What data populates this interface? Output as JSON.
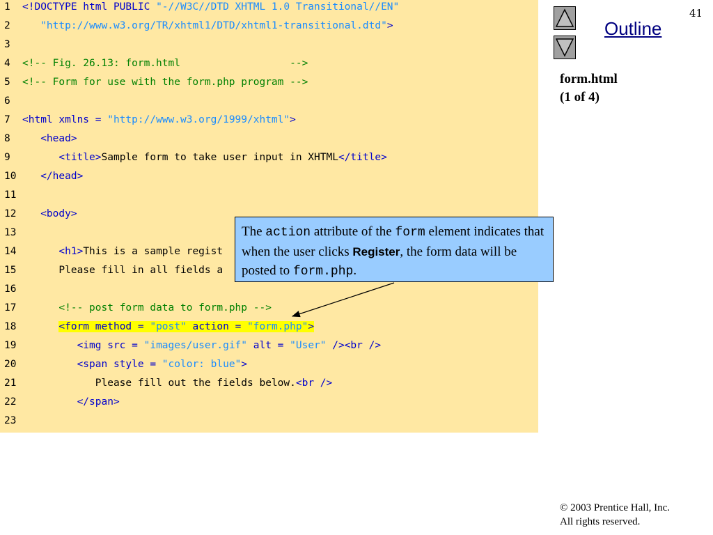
{
  "slide_number": "41",
  "outline_label": "Outline",
  "nav": {
    "up_icon": "triangle-up-icon",
    "down_icon": "triangle-down-icon"
  },
  "file": {
    "name": "form.html",
    "part": "(1 of 4)"
  },
  "code_lines": [
    {
      "num": "1",
      "indent": "",
      "tokens": [
        [
          "tag",
          "<!DOCTYPE html PUBLIC "
        ],
        [
          "str",
          "\"-//W3C//DTD XHTML 1.0 Transitional//EN\""
        ]
      ]
    },
    {
      "num": "2",
      "indent": "   ",
      "tokens": [
        [
          "str",
          "\"http://www.w3.org/TR/xhtml1/DTD/xhtml1-transitional.dtd\""
        ],
        [
          "tag",
          ">"
        ]
      ]
    },
    {
      "num": "3",
      "indent": "",
      "tokens": []
    },
    {
      "num": "4",
      "indent": "",
      "tokens": [
        [
          "cmt",
          "<!-- Fig. 26.13: form.html                  -->"
        ]
      ]
    },
    {
      "num": "5",
      "indent": "",
      "tokens": [
        [
          "cmt",
          "<!-- Form for use with the form.php program -->"
        ]
      ]
    },
    {
      "num": "6",
      "indent": "",
      "tokens": []
    },
    {
      "num": "7",
      "indent": "",
      "tokens": [
        [
          "tag",
          "<html xmlns = "
        ],
        [
          "str",
          "\"http://www.w3.org/1999/xhtml\""
        ],
        [
          "tag",
          ">"
        ]
      ]
    },
    {
      "num": "8",
      "indent": "   ",
      "tokens": [
        [
          "tag",
          "<head>"
        ]
      ]
    },
    {
      "num": "9",
      "indent": "      ",
      "tokens": [
        [
          "tag",
          "<title>"
        ],
        [
          "txt",
          "Sample form to take user input in XHTML"
        ],
        [
          "tag",
          "</title>"
        ]
      ]
    },
    {
      "num": "10",
      "indent": "   ",
      "tokens": [
        [
          "tag",
          "</head>"
        ]
      ]
    },
    {
      "num": "11",
      "indent": "",
      "tokens": []
    },
    {
      "num": "12",
      "indent": "   ",
      "tokens": [
        [
          "tag",
          "<body>"
        ]
      ]
    },
    {
      "num": "13",
      "indent": "",
      "tokens": []
    },
    {
      "num": "14",
      "indent": "      ",
      "tokens": [
        [
          "tag",
          "<h1>"
        ],
        [
          "txt",
          "This is a sample regist"
        ]
      ]
    },
    {
      "num": "15",
      "indent": "      ",
      "tokens": [
        [
          "txt",
          "Please fill in all fields a"
        ]
      ]
    },
    {
      "num": "16",
      "indent": "",
      "tokens": []
    },
    {
      "num": "17",
      "indent": "      ",
      "tokens": [
        [
          "cmt",
          "<!-- post form data to form.php -->"
        ]
      ]
    },
    {
      "num": "18",
      "indent": "      ",
      "highlight": true,
      "tokens": [
        [
          "tag",
          "<form method = "
        ],
        [
          "str",
          "\"post\""
        ],
        [
          "tag",
          " action = "
        ],
        [
          "str",
          "\"form.php\""
        ],
        [
          "tag",
          ">"
        ]
      ]
    },
    {
      "num": "19",
      "indent": "         ",
      "tokens": [
        [
          "tag",
          "<img src = "
        ],
        [
          "str",
          "\"images/user.gif\""
        ],
        [
          "tag",
          " alt = "
        ],
        [
          "str",
          "\"User\""
        ],
        [
          "tag",
          " /><br />"
        ]
      ]
    },
    {
      "num": "20",
      "indent": "         ",
      "tokens": [
        [
          "tag",
          "<span style = "
        ],
        [
          "str",
          "\"color: blue\""
        ],
        [
          "tag",
          ">"
        ]
      ]
    },
    {
      "num": "21",
      "indent": "            ",
      "tokens": [
        [
          "txt",
          "Please fill out the fields below."
        ],
        [
          "tag",
          "<br />"
        ]
      ]
    },
    {
      "num": "22",
      "indent": "         ",
      "tokens": [
        [
          "tag",
          "</span>"
        ]
      ]
    },
    {
      "num": "23",
      "indent": "",
      "tokens": []
    }
  ],
  "callout": {
    "t1": "The ",
    "m1": "action",
    "t2": " attribute of the ",
    "m2": "form",
    "t3": " element indicates that when the user clicks ",
    "b1": "Register",
    "t4": ", the form data will be posted to ",
    "m3": "form.php",
    "t5": "."
  },
  "copyright": {
    "symbol": "©",
    "line1": " 2003 Prentice Hall, Inc.",
    "line2": "All rights reserved."
  },
  "colors": {
    "code_bg": "#ffe8a3",
    "highlight": "#ffff00",
    "tag": "#0000cc",
    "string": "#1a8cff",
    "comment": "#008000",
    "callout_bg": "#99ccff",
    "outline": "#000080"
  }
}
